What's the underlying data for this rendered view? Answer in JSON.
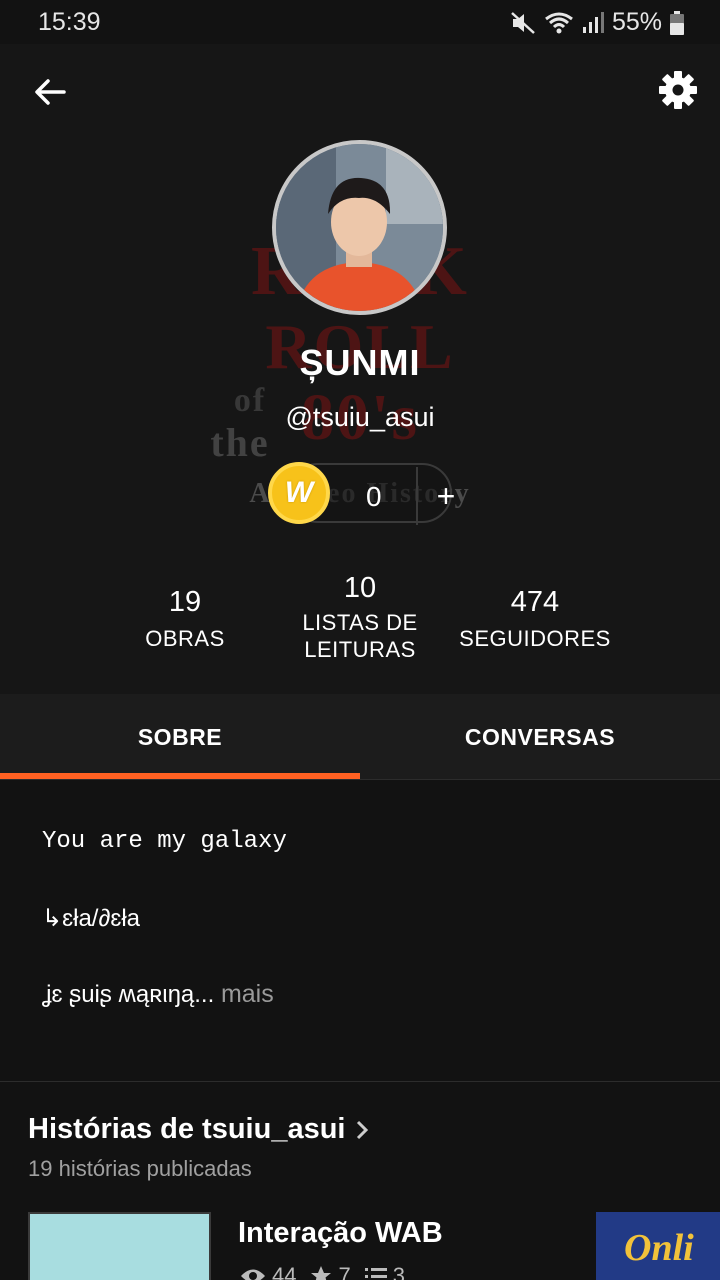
{
  "status_bar": {
    "time": "15:39",
    "battery_percent": "55%",
    "icons": [
      "mute-icon",
      "wifi-icon",
      "signal-icon",
      "battery-icon"
    ]
  },
  "header": {
    "back_icon": "arrow-left-icon",
    "settings_icon": "gear-icon",
    "background_cover_text": [
      "ROCK",
      "ROLL",
      "of",
      "the",
      "80's",
      "A Video History"
    ],
    "display_name": "ȘUNMI",
    "username": "@tsuiu_asui"
  },
  "coins": {
    "count": "0",
    "add_label": "+",
    "icon": "wattpad-coin-icon",
    "icon_letter": "W"
  },
  "stats": [
    {
      "value": "19",
      "label": "OBRAS"
    },
    {
      "value": "10",
      "label": "LISTAS DE LEITURAS"
    },
    {
      "value": "474",
      "label": "SEGUIDORES"
    }
  ],
  "tabs": [
    {
      "label": "SOBRE",
      "active": true
    },
    {
      "label": "CONVERSAS",
      "active": false
    }
  ],
  "about": {
    "lines": [
      "You are my galaxy",
      "↳ɛła/∂ɛła",
      "ʝɛ ʂuiʂ ʍąʀιŋą..."
    ],
    "more_label": "mais"
  },
  "stories": {
    "title": "Histórias de tsuiu_asui",
    "subtitle": "19 histórias publicadas",
    "items": [
      {
        "title": "Interação WAB",
        "views": "44",
        "votes": "7",
        "parts": "3"
      }
    ],
    "next_cover_text": "Onli"
  },
  "colors": {
    "accent": "#ff6122",
    "background": "#121212",
    "coin": "#f7c21a"
  }
}
